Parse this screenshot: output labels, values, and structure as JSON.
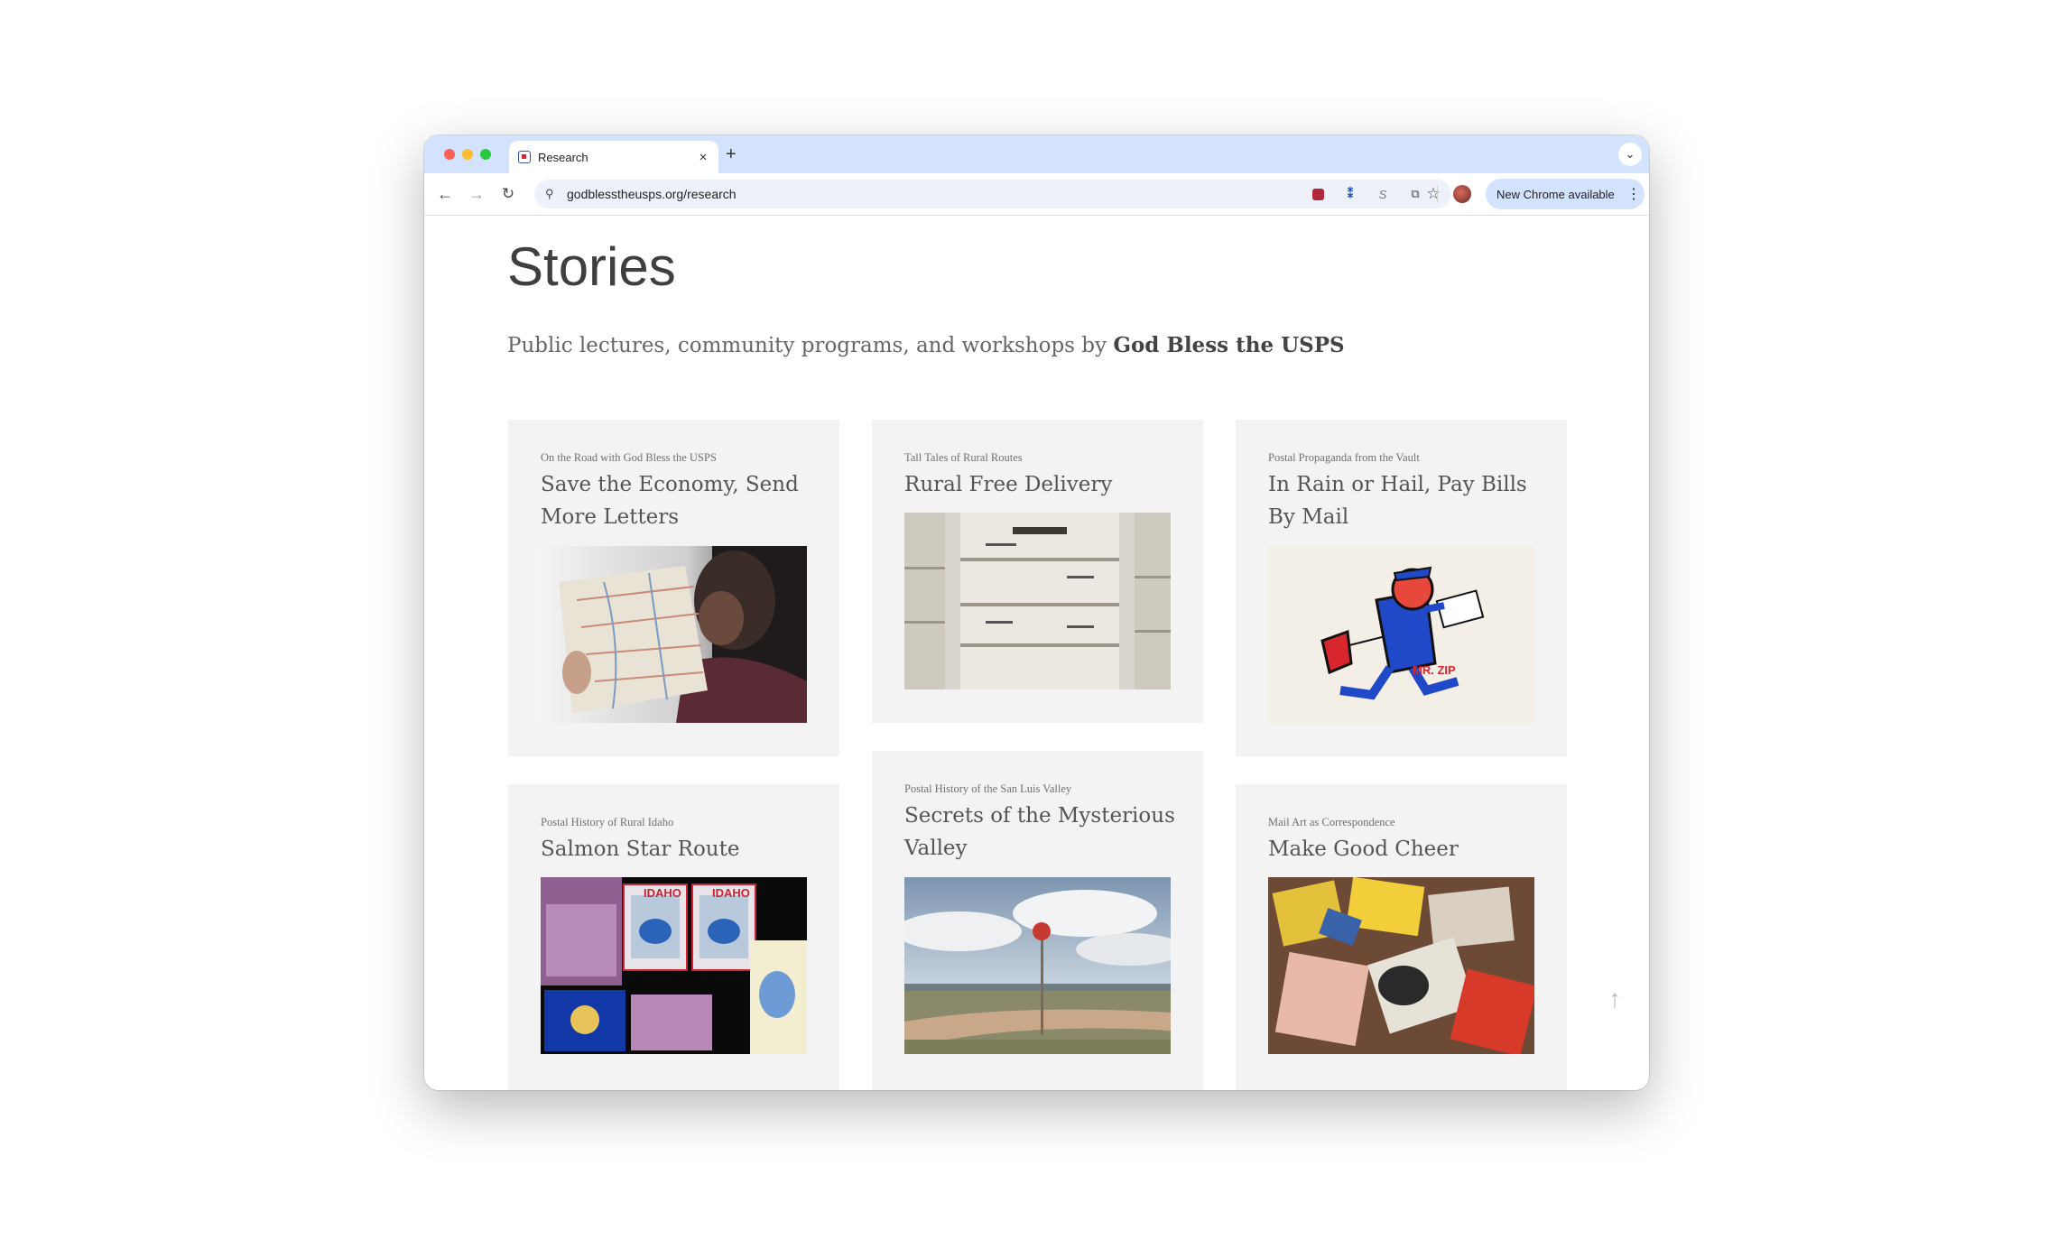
{
  "browser": {
    "tab_title": "Research",
    "tab_close_glyph": "×",
    "new_tab_glyph": "+",
    "tab_search_glyph": "⌄",
    "url": "godblesstheusps.org/research",
    "update_label": "New Chrome available",
    "update_menu_glyph": "⋮",
    "back_glyph": "←",
    "forward_glyph": "→",
    "reload_glyph": "↻",
    "site_info_glyph": "⚲",
    "star_glyph": "☆",
    "ext2_glyph": "⁑",
    "ext3_glyph": "S",
    "ext4_glyph": "⧉",
    "icons": [
      "back-icon",
      "forward-icon",
      "reload-icon",
      "site-info-icon",
      "bookmark-star-icon",
      "extension-icon",
      "profile-avatar-icon",
      "more-menu-icon"
    ]
  },
  "page": {
    "title": "Stories",
    "intro_prefix": "Public lectures, community programs, and workshops by ",
    "intro_brand": "God Bless the USPS",
    "back_to_top_glyph": "↑"
  },
  "cards": [
    {
      "kicker": "On the Road with God Bless the USPS",
      "title": "Save the Economy, Send More Letters",
      "image": "person reading a road map in a car"
    },
    {
      "kicker": "Tall Tales of Rural Routes",
      "title": "Rural Free Delivery",
      "image": "stacked U.S. Mail trays"
    },
    {
      "kicker": "Postal Propaganda from the Vault",
      "title": "In Rain or Hail, Pay Bills By Mail",
      "image": "Mr. ZIP mascot illustration",
      "image_text": "MR. ZIP"
    },
    {
      "kicker": "Postal History of Rural Idaho",
      "title": "Salmon Star Route",
      "image": "Idaho postage stamps",
      "image_text": "IDAHO"
    },
    {
      "kicker": "Postal History of the San Luis Valley",
      "title": "Secrets of the Mysterious Valley",
      "image": "dirt road with stop sign under cloudy sky"
    },
    {
      "kicker": "Mail Art as Correspondence",
      "title": "Make Good Cheer",
      "image": "collage of mail art envelopes"
    }
  ],
  "colors": {
    "tabstrip": "#d3e3fd",
    "card_bg": "#f3f3f3",
    "title_text": "#3f3f3f"
  }
}
